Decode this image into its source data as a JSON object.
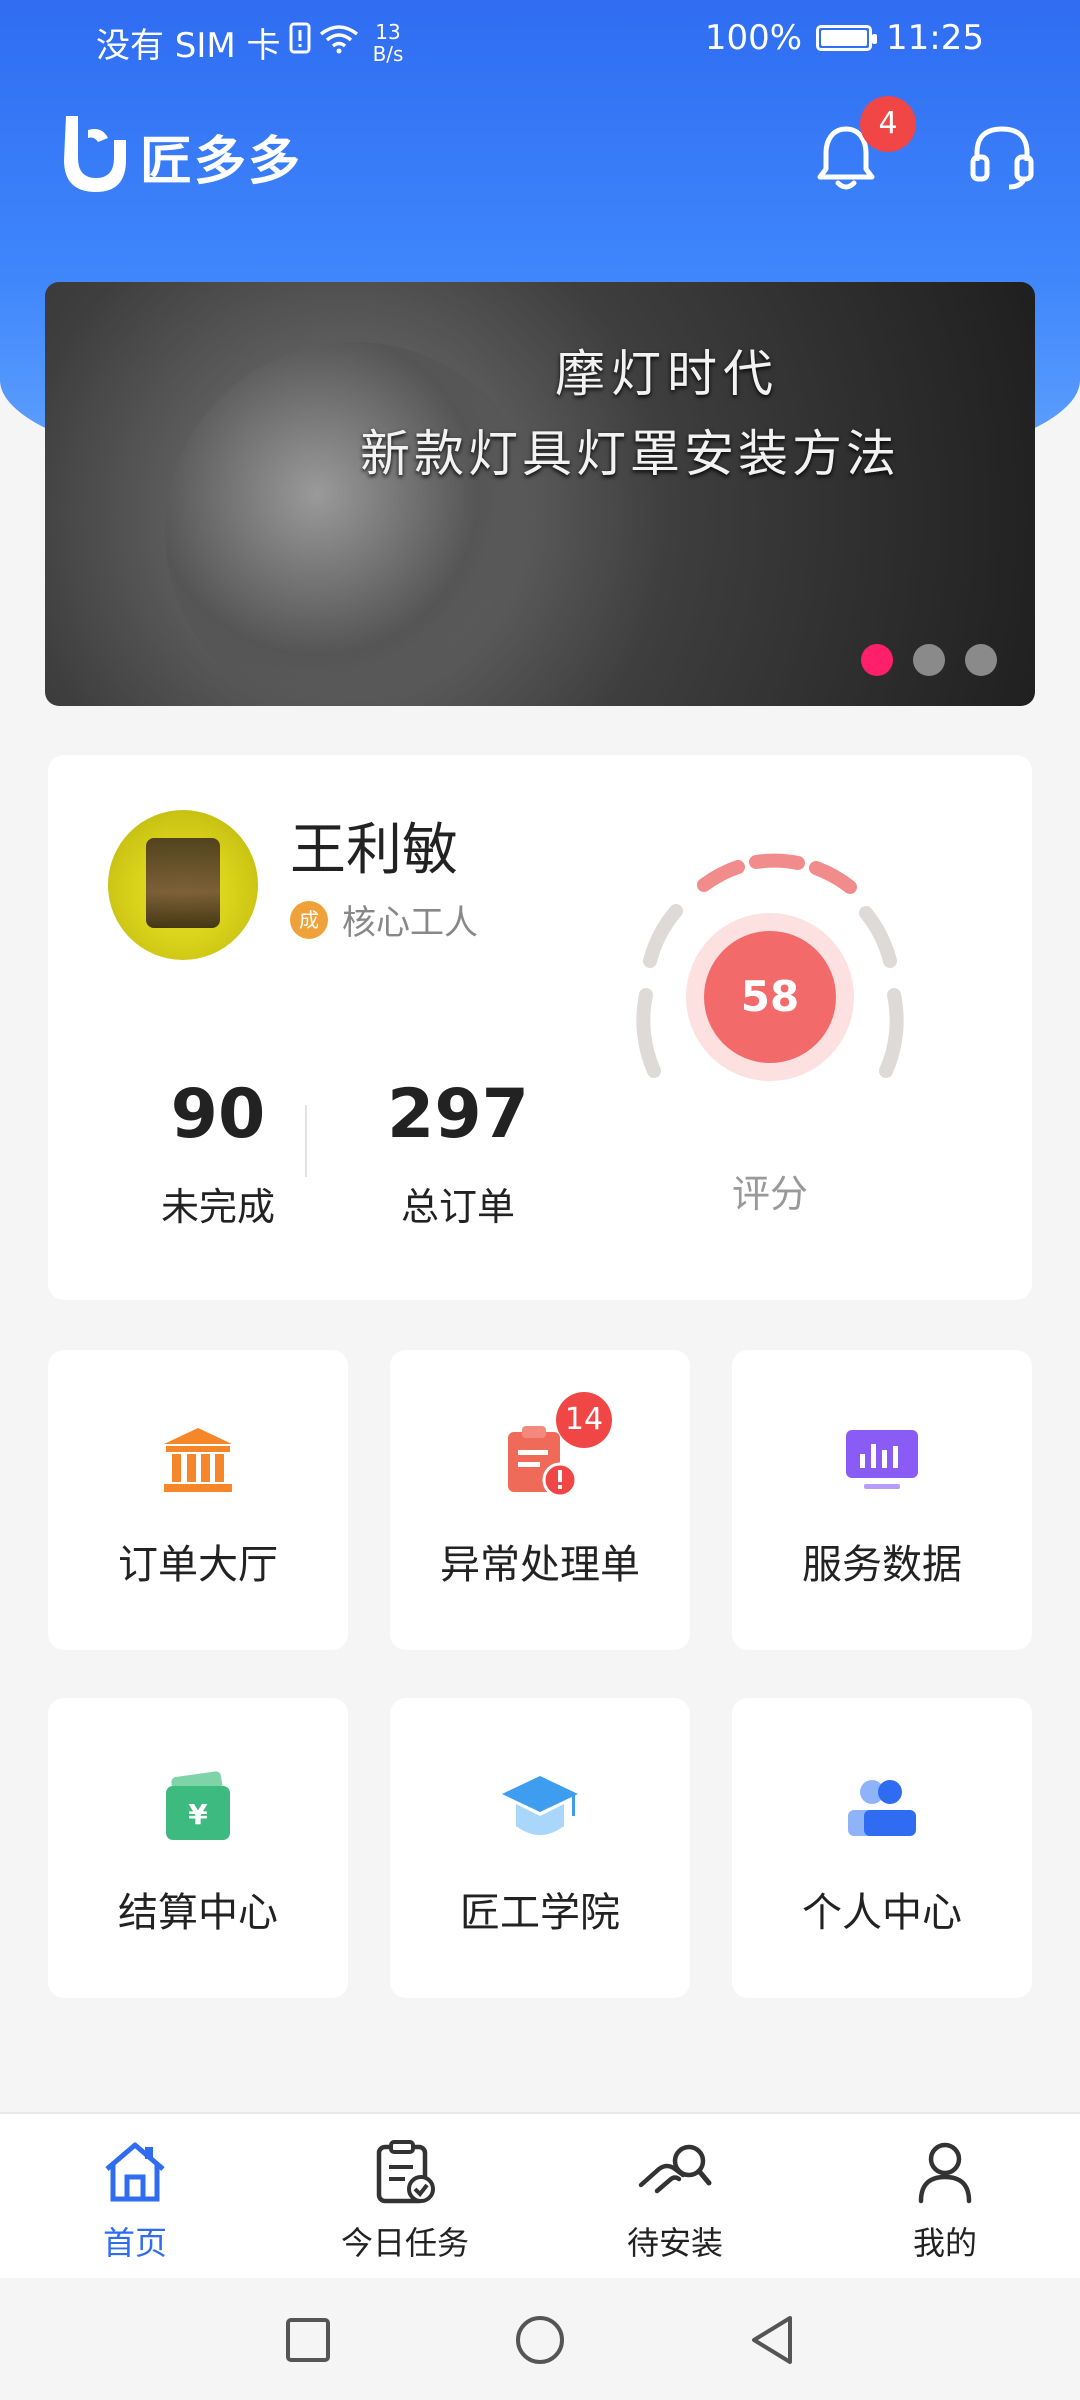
{
  "status_bar": {
    "carrier": "没有 SIM 卡",
    "net_speed_value": "13",
    "net_speed_unit": "B/s",
    "battery": "100%",
    "time": "11:25"
  },
  "header": {
    "app_name": "匠多多",
    "notification_count": "4"
  },
  "banner": {
    "line1": "摩灯时代",
    "line2": "新款灯具灯罩安装方法",
    "slide_count": 3,
    "active_slide": 1
  },
  "profile": {
    "name": "王利敏",
    "role": "核心工人",
    "role_badge": "成",
    "incomplete_count": "90",
    "incomplete_label": "未完成",
    "total_orders": "297",
    "total_orders_label": "总订单",
    "score": "58",
    "score_label": "评分"
  },
  "grid": [
    {
      "label": "订单大厅",
      "icon": "order-hall-icon",
      "color": "#f5872a"
    },
    {
      "label": "异常处理单",
      "icon": "exception-clipboard-icon",
      "color": "#f06a5a",
      "badge": "14"
    },
    {
      "label": "服务数据",
      "icon": "data-monitor-icon",
      "color": "#8a5cf5"
    },
    {
      "label": "结算中心",
      "icon": "wallet-icon",
      "color": "#3dba7f"
    },
    {
      "label": "匠工学院",
      "icon": "graduation-cap-icon",
      "color": "#5cb3f5"
    },
    {
      "label": "个人中心",
      "icon": "people-icon",
      "color": "#2f6cf2"
    }
  ],
  "bottom_nav": [
    {
      "label": "首页",
      "icon": "home-icon",
      "active": true
    },
    {
      "label": "今日任务",
      "icon": "task-icon",
      "active": false
    },
    {
      "label": "待安装",
      "icon": "install-icon",
      "active": false
    },
    {
      "label": "我的",
      "icon": "user-icon",
      "active": false
    }
  ],
  "colors": {
    "primary": "#2f6cf2",
    "badge": "#f04646",
    "score_red": "#f26a6a"
  }
}
